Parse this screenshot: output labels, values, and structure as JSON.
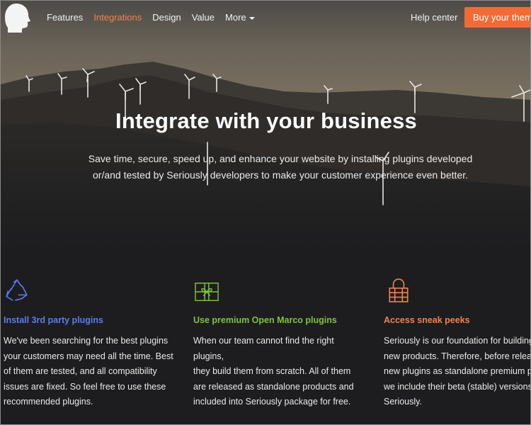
{
  "nav": {
    "links": [
      {
        "label": "Features"
      },
      {
        "label": "Integrations",
        "active": true
      },
      {
        "label": "Design"
      },
      {
        "label": "Value"
      },
      {
        "label": "More"
      }
    ],
    "help_label": "Help center",
    "buy_label": "Buy your theme"
  },
  "hero": {
    "title": "Integrate with your business",
    "subtitle_line1": "Save time, secure, speed up, and enhance your website by installing plugins developed",
    "subtitle_line2": "or/and tested by Seriously developers to make your customer experience even better."
  },
  "features": [
    {
      "icon": "recycle-icon",
      "color": "#5b7bf0",
      "title": "Install 3rd party plugins",
      "lines": [
        "We've been searching for the best plugins",
        "your customers may need all the time. Best",
        "of them are tested, and all compatibility",
        "issues are fixed. So feel free to use these",
        "recommended plugins."
      ]
    },
    {
      "icon": "gift-icon",
      "color": "#7fc241",
      "title": "Use premium Open Marco plugins",
      "lines": [
        "When our team cannot find the right plugins,",
        "they build them from scratch. All of them",
        "are released as standalone products and",
        "included into Seriously package for free."
      ]
    },
    {
      "icon": "lock-icon",
      "color": "#f0834d",
      "title": "Access sneak peeks",
      "lines": [
        "Seriously is our foundation for building",
        "new products. Therefore, before releasing",
        "new plugins as standalone premium products",
        "we include their beta (stable) versions here.",
        "Seriously."
      ]
    }
  ],
  "colors": {
    "accent": "#f0834d",
    "button": "#f26b35",
    "background": "#1d1d1f"
  }
}
